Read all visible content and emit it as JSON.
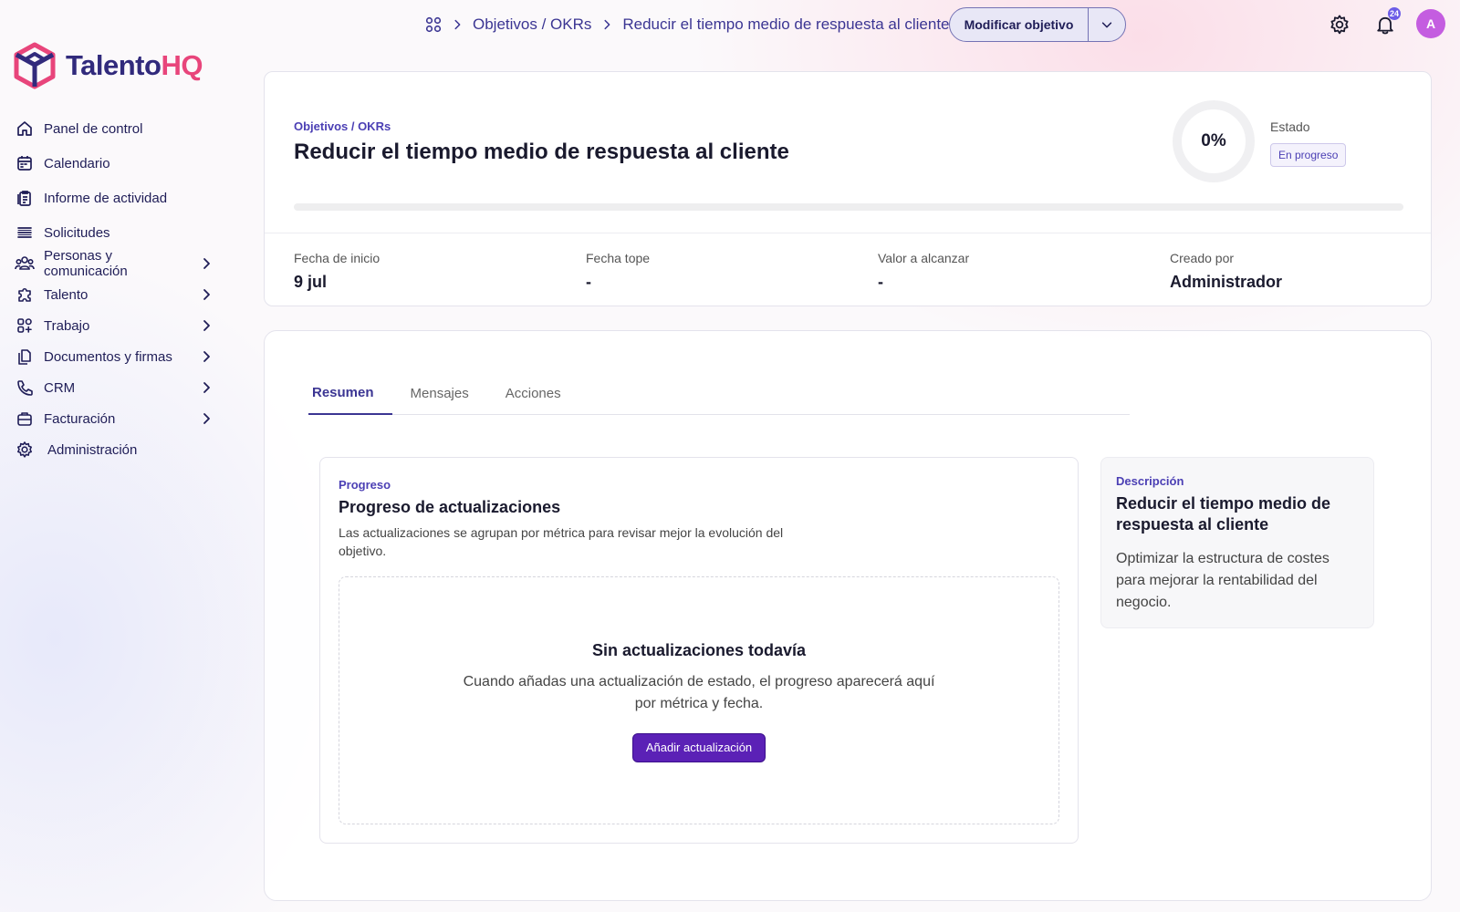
{
  "brand": {
    "name_main": "Talento",
    "name_accent": "HQ",
    "primary_color": "#312a7c",
    "accent_color": "#e8457b"
  },
  "sidebar": {
    "items": [
      {
        "label": "Panel de control",
        "icon": "home-icon",
        "has_submenu": false
      },
      {
        "label": "Calendario",
        "icon": "calendar-icon",
        "has_submenu": false
      },
      {
        "label": "Informe de actividad",
        "icon": "report-icon",
        "has_submenu": false
      },
      {
        "label": "Solicitudes",
        "icon": "list-icon",
        "has_submenu": false
      },
      {
        "label": "Personas y comunicación",
        "icon": "people-icon",
        "has_submenu": true
      },
      {
        "label": "Talento",
        "icon": "puzzle-icon",
        "has_submenu": true
      },
      {
        "label": "Trabajo",
        "icon": "apps-icon",
        "has_submenu": true
      },
      {
        "label": "Documentos y firmas",
        "icon": "documents-icon",
        "has_submenu": true
      },
      {
        "label": "CRM",
        "icon": "phone-icon",
        "has_submenu": true
      },
      {
        "label": "Facturación",
        "icon": "briefcase-icon",
        "has_submenu": true
      },
      {
        "label": "Administración",
        "icon": "gear-icon",
        "has_submenu": false
      }
    ]
  },
  "topbar": {
    "breadcrumb": [
      "Objetivos / OKRs",
      "Reducir el tiempo medio de respuesta al cliente"
    ],
    "modify_button": "Modificar objetivo",
    "notification_count": "24",
    "avatar_initial": "A"
  },
  "header": {
    "eyebrow": "Objetivos / OKRs",
    "title": "Reducir el tiempo medio de respuesta al cliente",
    "progress_label": "0%",
    "progress_fraction": 0,
    "estado_label": "Estado",
    "estado_value": "En progreso",
    "meta": [
      {
        "label": "Fecha de inicio",
        "value": "9 jul"
      },
      {
        "label": "Fecha tope",
        "value": "-"
      },
      {
        "label": "Valor a alcanzar",
        "value": "-"
      },
      {
        "label": "Creado por",
        "value": "Administrador"
      }
    ]
  },
  "tabs": [
    {
      "label": "Resumen",
      "active": true
    },
    {
      "label": "Mensajes",
      "active": false
    },
    {
      "label": "Acciones",
      "active": false
    }
  ],
  "progress_card": {
    "eyebrow": "Progreso",
    "title": "Progreso de actualizaciones",
    "description": "Las actualizaciones se agrupan por métrica para revisar mejor la evolución del objetivo.",
    "empty_title": "Sin actualizaciones todavía",
    "empty_text": "Cuando añadas una actualización de estado, el progreso aparecerá aquí por métrica y fecha.",
    "add_button": "Añadir actualización"
  },
  "description_card": {
    "eyebrow": "Descripción",
    "title": "Reducir el tiempo medio de respuesta al cliente",
    "text": "Optimizar la estructura de costes para mejorar la rentabilidad del negocio."
  }
}
